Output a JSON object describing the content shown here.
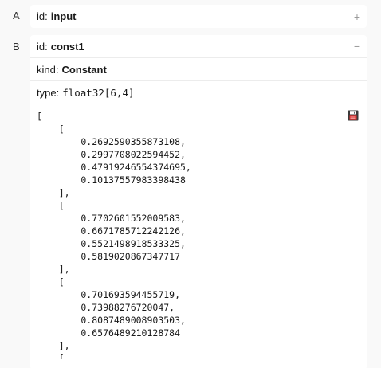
{
  "nodes": [
    {
      "letter": "A",
      "id_label": "id:",
      "id_value": "input",
      "toggle": "+"
    },
    {
      "letter": "B",
      "id_label": "id:",
      "id_value": "const1",
      "toggle": "−",
      "kind_label": "kind:",
      "kind_value": "Constant",
      "type_label": "type:",
      "type_value": "float32[6,4]",
      "value_text": "[\n    [\n        0.2692590355873108,\n        0.2997708022594452,\n        0.47919246554374695,\n        0.10137557983398438\n    ],\n    [\n        0.7702601552009583,\n        0.6671785712242126,\n        0.5521498918533325,\n        0.5819020867347717\n    ],\n    [\n        0.701693594455719,\n        0.73988276720047,\n        0.8087489008903503,\n        0.6576489210128784\n    ],\n    [",
      "save_icon": "floppy-disk-icon"
    }
  ]
}
